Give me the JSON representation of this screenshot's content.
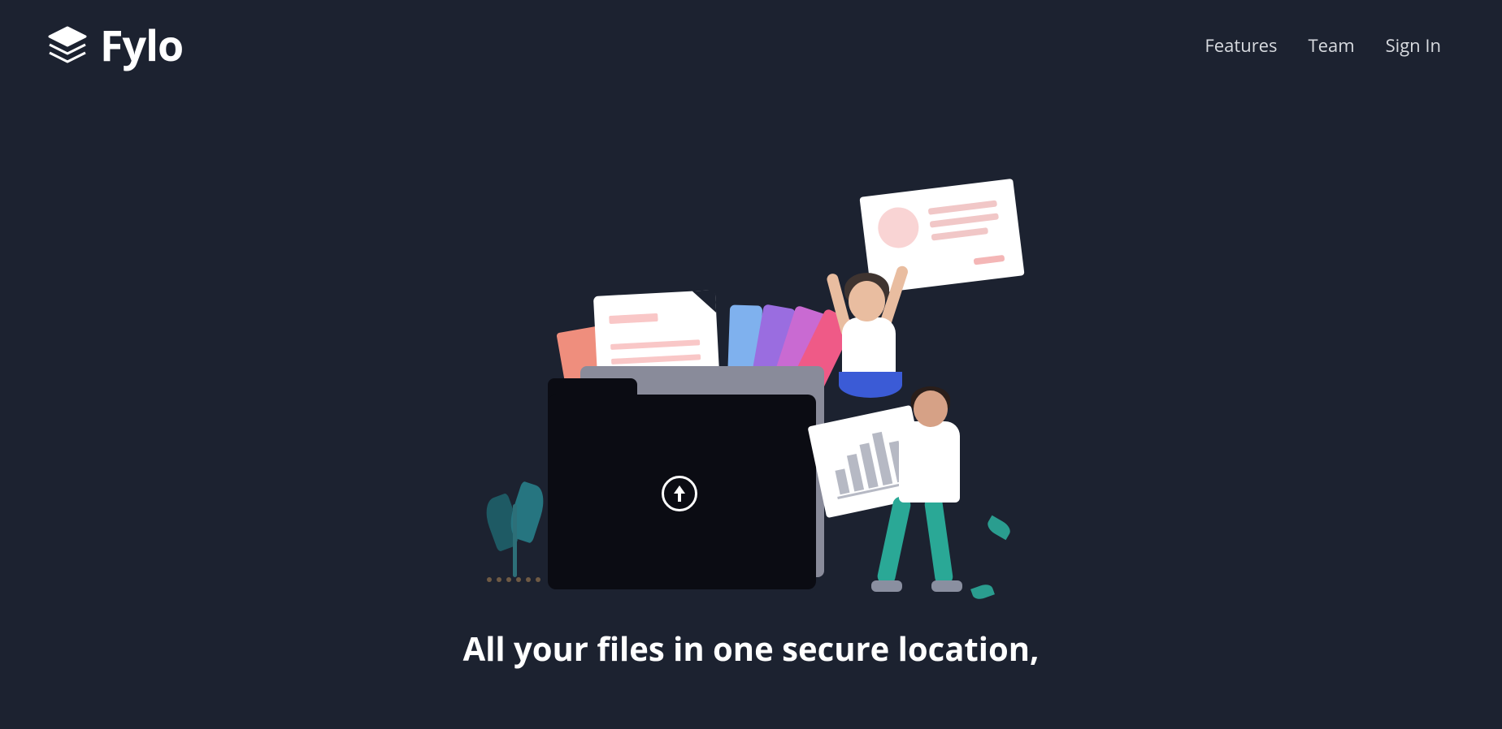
{
  "brand": {
    "name": "Fylo"
  },
  "nav": {
    "items": [
      {
        "label": "Features"
      },
      {
        "label": "Team"
      },
      {
        "label": "Sign In"
      }
    ]
  },
  "hero": {
    "title": "All your files in one secure location,"
  },
  "colors": {
    "bg": "#1c2230",
    "accent": "#2aa896"
  }
}
